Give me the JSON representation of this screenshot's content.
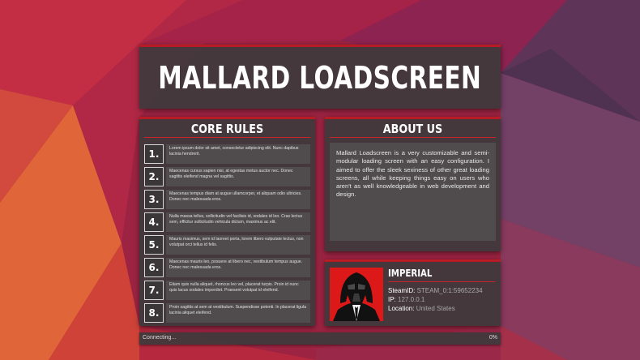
{
  "header": {
    "title": "MALLARD LOADSCREEN"
  },
  "rules": {
    "heading": "CORE RULES",
    "items": [
      {
        "num": "1.",
        "text": "Lorem ipsum dolor sit amet, consectetur adipiscing elit. Nunc dapibus lacinia hendrerit."
      },
      {
        "num": "2.",
        "text": "Maecenas cursus sapien nisi, at egestas metus auctor nec. Donec sagittis eleifend magna vel sagittis."
      },
      {
        "num": "3.",
        "text": "Maecenas tempus diam at augue ullamcorper, et aliquam odio ultricies. Donec nec malesuada eros."
      },
      {
        "num": "4.",
        "text": "Nulla massa tellus, sollicitudin vel facilisis id, sodales id leo. Cras lectus sem, efficitur sollicitudin vehicula dictum, maximus ac elit."
      },
      {
        "num": "5.",
        "text": "Mauris maximus, sem id laoreet porta, lorem libero vulputate lectus, non volutpat orci tellus id felis."
      },
      {
        "num": "6.",
        "text": "Maecenas mauris leo, posuere at libero nec, vestibulum tempus augue. Donec nec malesuada eros."
      },
      {
        "num": "7.",
        "text": "Etiam quis nulla aliquet, rhoncus leo vel, placerat turpis. Proin id nunc quis lacus sodales imperdiet. Praesent volutpat id eleifend."
      },
      {
        "num": "8.",
        "text": "Proin sagittis at sem at vestibulum. Suspendisse potenti. In placerat ligula lacinia aliquet eleifend."
      }
    ]
  },
  "about": {
    "heading": "ABOUT US",
    "text": "Mallard Loadscreen is a very customizable and semi-modular loading screen with an easy configuration. I aimed to offer the sleek sexiness of other great loading screens, all while keeping things easy on users who aren't as well knowledgeable in web development and design."
  },
  "profile": {
    "name": "IMPERIAL",
    "steamid_label": "SteamID:",
    "steamid_value": "STEAM_0:1:59652234",
    "ip_label": "IP:",
    "ip_value": "127.0.0.1",
    "location_label": "Location:",
    "location_value": "United States"
  },
  "status": {
    "text": "Connecting...",
    "percent_label": "0%",
    "progress": 0
  },
  "colors": {
    "accent": "#b71c24",
    "panel": "#3e3a3c",
    "avatar_bg": "#dd1818"
  },
  "icons": {
    "avatar": "darth-vader-avatar-icon"
  }
}
